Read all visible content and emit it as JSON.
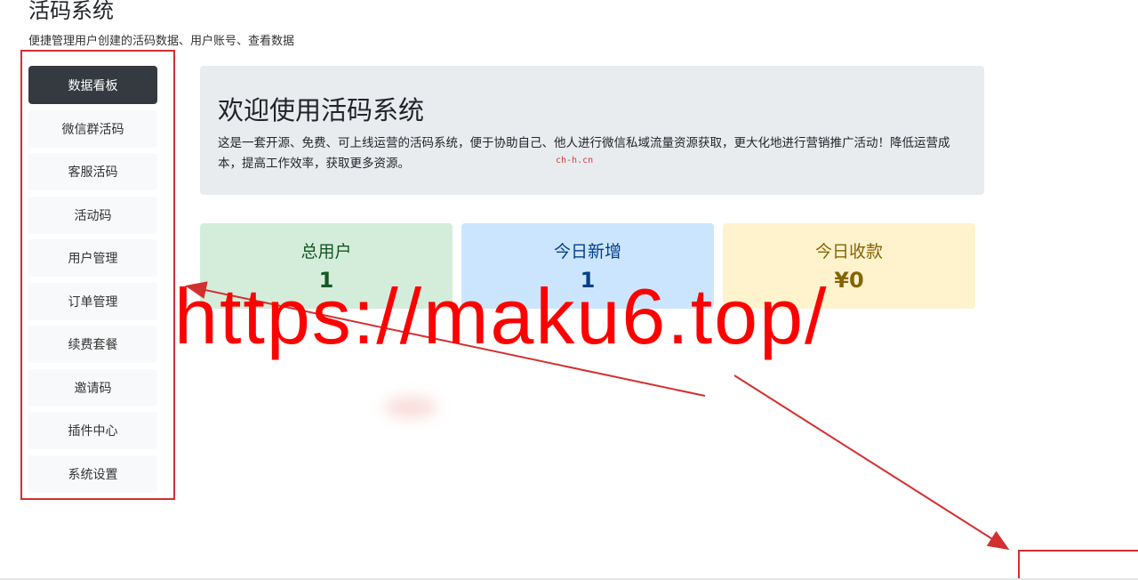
{
  "header": {
    "title": "活码系统",
    "subtitle": "便捷管理用户创建的活码数据、用户账号、查看数据"
  },
  "sidebar": {
    "items": [
      {
        "label": "数据看板",
        "active": true
      },
      {
        "label": "微信群活码",
        "active": false
      },
      {
        "label": "客服活码",
        "active": false
      },
      {
        "label": "活动码",
        "active": false
      },
      {
        "label": "用户管理",
        "active": false
      },
      {
        "label": "订单管理",
        "active": false
      },
      {
        "label": "续费套餐",
        "active": false
      },
      {
        "label": "邀请码",
        "active": false
      },
      {
        "label": "插件中心",
        "active": false
      },
      {
        "label": "系统设置",
        "active": false
      }
    ]
  },
  "welcome": {
    "title": "欢迎使用活码系统",
    "description": "这是一套开源、免费、可上线运营的活码系统，便于协助自己、他人进行微信私域流量资源获取，更大化地进行营销推广活动！降低运营成本，提高工作效率，获取更多资源。",
    "watermark": "ch-h.cn"
  },
  "stats": {
    "total_users": {
      "label": "总用户",
      "value": "1"
    },
    "new_today": {
      "label": "今日新增",
      "value": "1"
    },
    "revenue_today": {
      "label": "今日收款",
      "value": "¥0"
    }
  },
  "overlay": {
    "watermark_url": "https://maku6.top/",
    "annotation_color": "#d32f2f"
  }
}
